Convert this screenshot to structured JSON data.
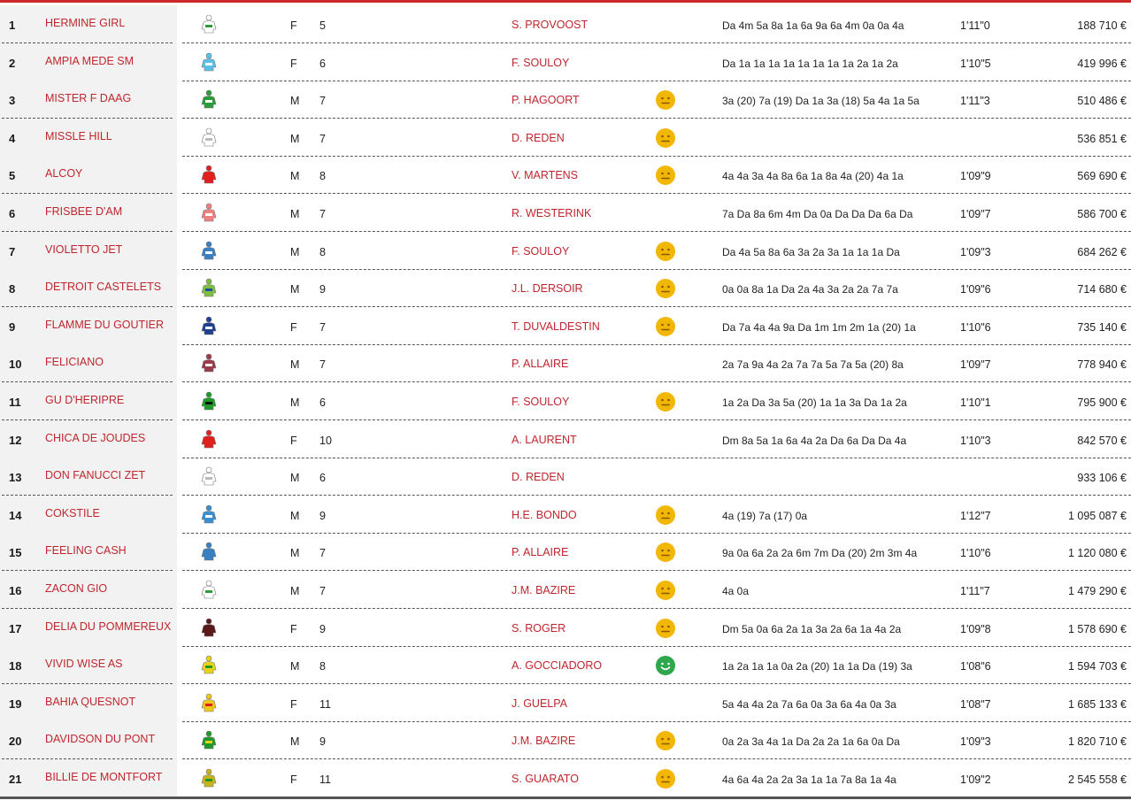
{
  "colors": {
    "accent": "#c0262d",
    "mood_neutral": "#f2b705",
    "mood_happy": "#2ea84a"
  },
  "runners": [
    {
      "num": "1",
      "name": "HERMINE GIRL",
      "silk_icon": "jockey-silk-white-green-icon",
      "silk_color": "#ffffff",
      "silk_accent": "#2e9b3a",
      "sex": "F",
      "age": "5",
      "driver": "S. PROVOOST",
      "mood": "",
      "form": "Da 4m 5a 8a 1a 6a 9a 6a 4m 0a 0a 4a",
      "record": "1'11\"0",
      "gains": "188 710 €"
    },
    {
      "num": "2",
      "name": "AMPIA MEDE SM",
      "silk_icon": "jockey-silk-light-blue-icon",
      "silk_color": "#5bc0e8",
      "silk_accent": "#ffffff",
      "sex": "F",
      "age": "6",
      "driver": "F. SOULOY",
      "mood": "",
      "form": "Da 1a 1a 1a 1a 1a 1a 1a 1a 2a 1a 2a",
      "record": "1'10\"5",
      "gains": "419 996 €"
    },
    {
      "num": "3",
      "name": "MISTER F DAAG",
      "silk_icon": "jockey-silk-green-white-stripes-icon",
      "silk_color": "#2e9b3a",
      "silk_accent": "#ffffff",
      "sex": "M",
      "age": "7",
      "driver": "P. HAGOORT",
      "mood": "neutral",
      "form": "3a (20) 7a (19) Da 1a 3a (18) 5a 4a 1a 5a",
      "record": "1'11\"3",
      "gains": "510 486 €"
    },
    {
      "num": "4",
      "name": "MISSLE HILL",
      "silk_icon": "jockey-silk-white-icon",
      "silk_color": "#ffffff",
      "silk_accent": "#bbbbbb",
      "sex": "M",
      "age": "7",
      "driver": "D. REDEN",
      "mood": "neutral",
      "form": "",
      "record": "",
      "gains": "536 851 €"
    },
    {
      "num": "5",
      "name": "ALCOY",
      "silk_icon": "jockey-silk-red-icon",
      "silk_color": "#e0201f",
      "silk_accent": "#e0201f",
      "sex": "M",
      "age": "8",
      "driver": "V. MARTENS",
      "mood": "neutral",
      "form": "4a 4a 3a 4a 8a 6a 1a 8a 4a (20) 4a 1a",
      "record": "1'09\"9",
      "gains": "569 690 €"
    },
    {
      "num": "6",
      "name": "FRISBEE D'AM",
      "silk_icon": "jockey-silk-red-white-check-icon",
      "silk_color": "#f08080",
      "silk_accent": "#ffffff",
      "sex": "M",
      "age": "7",
      "driver": "R. WESTERINK",
      "mood": "",
      "form": "7a Da 8a 6m 4m Da 0a Da Da Da 6a Da",
      "record": "1'09\"7",
      "gains": "586 700 €"
    },
    {
      "num": "7",
      "name": "VIOLETTO JET",
      "silk_icon": "jockey-silk-blue-icon",
      "silk_color": "#3a7fc0",
      "silk_accent": "#ffffff",
      "sex": "M",
      "age": "8",
      "driver": "F. SOULOY",
      "mood": "neutral",
      "form": "Da 4a 5a 8a 6a 3a 2a 3a 1a 1a 1a Da",
      "record": "1'09\"3",
      "gains": "684 262 €"
    },
    {
      "num": "8",
      "name": "DETROIT CASTELETS",
      "silk_icon": "jockey-silk-green-yellow-stripes-icon",
      "silk_color": "#7fbf3f",
      "silk_accent": "#1f4fa0",
      "sex": "M",
      "age": "9",
      "driver": "J.L. DERSOIR",
      "mood": "neutral",
      "form": "0a 0a 8a 1a Da 2a 4a 3a 2a 2a 7a 7a",
      "record": "1'09\"6",
      "gains": "714 680 €"
    },
    {
      "num": "9",
      "name": "FLAMME DU GOUTIER",
      "silk_icon": "jockey-silk-navy-star-icon",
      "silk_color": "#1f3f8f",
      "silk_accent": "#ffffff",
      "sex": "F",
      "age": "7",
      "driver": "T. DUVALDESTIN",
      "mood": "neutral",
      "form": "Da 7a 4a 4a 9a Da 1m 1m 2m 1a (20) 1a",
      "record": "1'10\"6",
      "gains": "735 140 €"
    },
    {
      "num": "10",
      "name": "FELICIANO",
      "silk_icon": "jockey-silk-maroon-check-icon",
      "silk_color": "#9a3a4a",
      "silk_accent": "#ffffff",
      "sex": "M",
      "age": "7",
      "driver": "P. ALLAIRE",
      "mood": "",
      "form": "2a 7a 9a 4a 2a 7a 7a 5a 7a 5a (20) 8a",
      "record": "1'09\"7",
      "gains": "778 940 €"
    },
    {
      "num": "11",
      "name": "GU D'HERIPRE",
      "silk_icon": "jockey-silk-green-black-icon",
      "silk_color": "#1f9a2a",
      "silk_accent": "#111111",
      "sex": "M",
      "age": "6",
      "driver": "F. SOULOY",
      "mood": "neutral",
      "form": "1a 2a Da 3a 5a (20) 1a 1a 3a Da 1a 2a",
      "record": "1'10\"1",
      "gains": "795 900 €"
    },
    {
      "num": "12",
      "name": "CHICA DE JOUDES",
      "silk_icon": "jockey-silk-red-icon",
      "silk_color": "#e0201f",
      "silk_accent": "#e0201f",
      "sex": "F",
      "age": "10",
      "driver": "A. LAURENT",
      "mood": "",
      "form": "Dm 8a 5a 1a 6a 4a 2a Da 6a Da Da 4a",
      "record": "1'10\"3",
      "gains": "842 570 €"
    },
    {
      "num": "13",
      "name": "DON FANUCCI ZET",
      "silk_icon": "jockey-silk-white-icon",
      "silk_color": "#ffffff",
      "silk_accent": "#bbbbbb",
      "sex": "M",
      "age": "6",
      "driver": "D. REDEN",
      "mood": "",
      "form": "",
      "record": "",
      "gains": "933 106 €"
    },
    {
      "num": "14",
      "name": "COKSTILE",
      "silk_icon": "jockey-silk-blue-white-icon",
      "silk_color": "#3a8fd0",
      "silk_accent": "#ffffff",
      "sex": "M",
      "age": "9",
      "driver": "H.E. BONDO",
      "mood": "neutral",
      "form": "4a (19) 7a (17) 0a",
      "record": "1'12\"7",
      "gains": "1 095 087 €"
    },
    {
      "num": "15",
      "name": "FEELING CASH",
      "silk_icon": "jockey-silk-blue-icon",
      "silk_color": "#3a7fc0",
      "silk_accent": "#3a7fc0",
      "sex": "M",
      "age": "7",
      "driver": "P. ALLAIRE",
      "mood": "neutral",
      "form": "9a 0a 6a 2a 2a 6m 7m Da (20) 2m 3m 4a",
      "record": "1'10\"6",
      "gains": "1 120 080 €"
    },
    {
      "num": "16",
      "name": "ZACON GIO",
      "silk_icon": "jockey-silk-white-green-icon",
      "silk_color": "#ffffff",
      "silk_accent": "#2e9b3a",
      "sex": "M",
      "age": "7",
      "driver": "J.M. BAZIRE",
      "mood": "neutral",
      "form": "4a 0a",
      "record": "1'11\"7",
      "gains": "1 479 290 €"
    },
    {
      "num": "17",
      "name": "DELIA DU POMMEREUX",
      "silk_icon": "jockey-silk-maroon-icon",
      "silk_color": "#5a1a1a",
      "silk_accent": "#5a1a1a",
      "sex": "F",
      "age": "9",
      "driver": "S. ROGER",
      "mood": "neutral",
      "form": "Dm 5a 0a 6a 2a 1a 3a 2a 6a 1a 4a 2a",
      "record": "1'09\"8",
      "gains": "1 578 690 €"
    },
    {
      "num": "18",
      "name": "VIVID WISE AS",
      "silk_icon": "jockey-silk-yellow-green-icon",
      "silk_color": "#e8d21a",
      "silk_accent": "#1f9a2a",
      "sex": "M",
      "age": "8",
      "driver": "A. GOCCIADORO",
      "mood": "happy",
      "form": "1a 2a 1a 1a 0a 2a (20) 1a 1a Da (19) 3a",
      "record": "1'08\"6",
      "gains": "1 594 703 €"
    },
    {
      "num": "19",
      "name": "BAHIA QUESNOT",
      "silk_icon": "jockey-silk-yellow-red-icon",
      "silk_color": "#f0c81a",
      "silk_accent": "#e0201f",
      "sex": "F",
      "age": "11",
      "driver": "J. GUELPA",
      "mood": "",
      "form": "5a 4a 4a 2a 7a 6a 0a 3a 6a 4a 0a 3a",
      "record": "1'08\"7",
      "gains": "1 685 133 €"
    },
    {
      "num": "20",
      "name": "DAVIDSON DU PONT",
      "silk_icon": "jockey-silk-green-yellow-icon",
      "silk_color": "#1f9a2a",
      "silk_accent": "#e8d21a",
      "sex": "M",
      "age": "9",
      "driver": "J.M. BAZIRE",
      "mood": "neutral",
      "form": "0a 2a 3a 4a 1a Da 2a 2a 1a 6a 0a Da",
      "record": "1'09\"3",
      "gains": "1 820 710 €"
    },
    {
      "num": "21",
      "name": "BILLIE DE MONTFORT",
      "silk_icon": "jockey-silk-yellow-green-icon",
      "silk_color": "#c8b41a",
      "silk_accent": "#1f9a2a",
      "sex": "F",
      "age": "11",
      "driver": "S. GUARATO",
      "mood": "neutral",
      "form": "4a 6a 4a 2a 2a 3a 1a 1a 7a 8a 1a 4a",
      "record": "1'09\"2",
      "gains": "2 545 558 €"
    }
  ]
}
